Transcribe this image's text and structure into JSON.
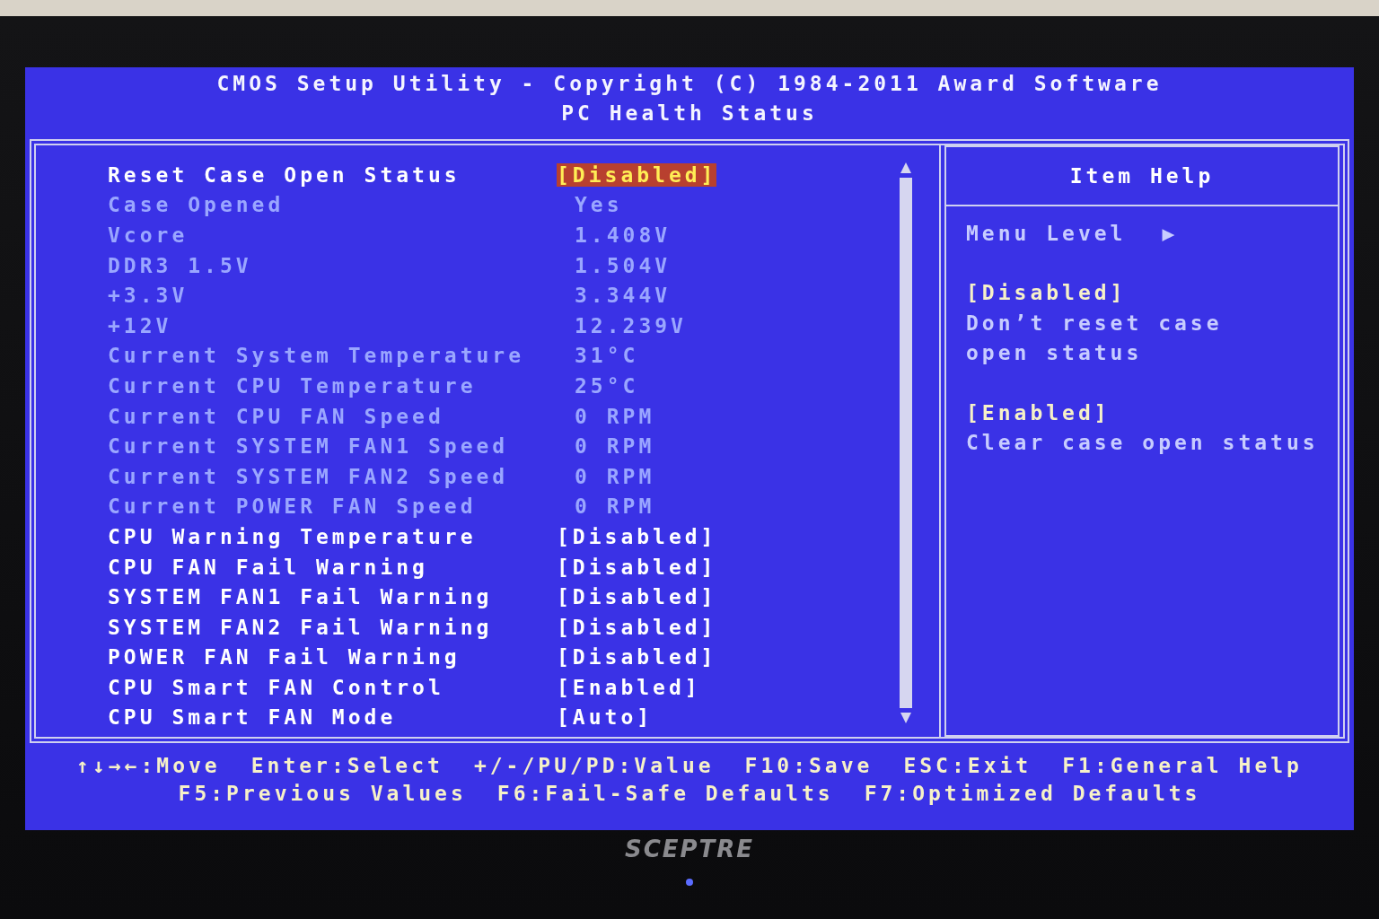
{
  "header": {
    "title": "CMOS Setup Utility - Copyright (C) 1984-2011 Award Software",
    "subtitle": "PC Health Status"
  },
  "items": [
    {
      "kind": "setting",
      "label": "Reset Case Open Status",
      "value": "[Disabled]",
      "selected": true,
      "disabled": false
    },
    {
      "kind": "reading",
      "label": "Case Opened",
      "value": "Yes",
      "selected": false,
      "disabled": true
    },
    {
      "kind": "reading",
      "label": "Vcore",
      "value": "1.408V",
      "selected": false,
      "disabled": true
    },
    {
      "kind": "reading",
      "label": "DDR3 1.5V",
      "value": "1.504V",
      "selected": false,
      "disabled": true
    },
    {
      "kind": "reading",
      "label": "+3.3V",
      "value": "3.344V",
      "selected": false,
      "disabled": true
    },
    {
      "kind": "reading",
      "label": "+12V",
      "value": "12.239V",
      "selected": false,
      "disabled": true
    },
    {
      "kind": "reading",
      "label": "Current System Temperature",
      "value": "31°C",
      "selected": false,
      "disabled": true
    },
    {
      "kind": "reading",
      "label": "Current CPU Temperature",
      "value": "25°C",
      "selected": false,
      "disabled": true
    },
    {
      "kind": "reading",
      "label": "Current CPU FAN Speed",
      "value": "0 RPM",
      "selected": false,
      "disabled": true
    },
    {
      "kind": "reading",
      "label": "Current SYSTEM FAN1 Speed",
      "value": "0 RPM",
      "selected": false,
      "disabled": true
    },
    {
      "kind": "reading",
      "label": "Current SYSTEM FAN2 Speed",
      "value": "0 RPM",
      "selected": false,
      "disabled": true
    },
    {
      "kind": "reading",
      "label": "Current POWER FAN Speed",
      "value": "0 RPM",
      "selected": false,
      "disabled": true
    },
    {
      "kind": "setting",
      "label": "CPU Warning Temperature",
      "value": "[Disabled]",
      "selected": false,
      "disabled": false
    },
    {
      "kind": "setting",
      "label": "CPU FAN Fail Warning",
      "value": "[Disabled]",
      "selected": false,
      "disabled": false
    },
    {
      "kind": "setting",
      "label": "SYSTEM FAN1 Fail Warning",
      "value": "[Disabled]",
      "selected": false,
      "disabled": false
    },
    {
      "kind": "setting",
      "label": "SYSTEM FAN2 Fail Warning",
      "value": "[Disabled]",
      "selected": false,
      "disabled": false
    },
    {
      "kind": "setting",
      "label": "POWER FAN Fail Warning",
      "value": "[Disabled]",
      "selected": false,
      "disabled": false
    },
    {
      "kind": "setting",
      "label": "CPU Smart FAN Control",
      "value": "[Enabled]",
      "selected": false,
      "disabled": false
    },
    {
      "kind": "setting",
      "label": "CPU Smart FAN Mode",
      "value": "[Auto]",
      "selected": false,
      "disabled": false
    }
  ],
  "help": {
    "title": "Item Help",
    "menu_level": "Menu Level",
    "menu_level_marker": "▶",
    "entries": [
      {
        "option": "[Disabled]",
        "lines": [
          "Don’t reset case",
          "open status"
        ]
      },
      {
        "option": "[Enabled]",
        "lines": [
          "Clear case open status"
        ]
      }
    ]
  },
  "footer": {
    "top_line": [
      {
        "key": "↑↓→←",
        "action": ":Move"
      },
      {
        "key": "Enter",
        "action": ":Select"
      },
      {
        "key": "+/-/PU/PD",
        "action": ":Value"
      },
      {
        "key": "F10",
        "action": ":Save"
      },
      {
        "key": "ESC",
        "action": ":Exit"
      },
      {
        "key": "F1",
        "action": ":General Help"
      }
    ],
    "bottom_line": [
      {
        "key": "F5",
        "action": ":Previous Values"
      },
      {
        "key": "F6",
        "action": ":Fail-Safe Defaults"
      },
      {
        "key": "F7",
        "action": ":Optimized Defaults"
      }
    ]
  },
  "monitor": {
    "brand": "SCEPTRE"
  }
}
